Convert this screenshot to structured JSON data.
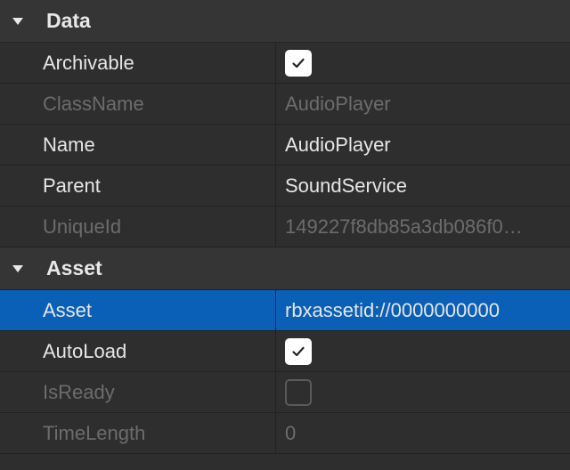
{
  "sections": [
    {
      "title": "Data",
      "rows": [
        {
          "name": "Archivable",
          "type": "checkbox",
          "checked": true,
          "enabled": true
        },
        {
          "name": "ClassName",
          "type": "text",
          "value": "AudioPlayer",
          "enabled": false
        },
        {
          "name": "Name",
          "type": "text",
          "value": "AudioPlayer",
          "enabled": true
        },
        {
          "name": "Parent",
          "type": "text",
          "value": "SoundService",
          "enabled": true
        },
        {
          "name": "UniqueId",
          "type": "text",
          "value": "149227f8db85a3db086f0…",
          "enabled": false
        }
      ]
    },
    {
      "title": "Asset",
      "rows": [
        {
          "name": "Asset",
          "type": "text",
          "value": "rbxassetid://0000000000",
          "enabled": true,
          "selected": true
        },
        {
          "name": "AutoLoad",
          "type": "checkbox",
          "checked": true,
          "enabled": true
        },
        {
          "name": "IsReady",
          "type": "checkbox",
          "checked": false,
          "enabled": false
        },
        {
          "name": "TimeLength",
          "type": "text",
          "value": "0",
          "enabled": false
        }
      ]
    }
  ],
  "colors": {
    "background": "#2e2e2e",
    "header": "#353535",
    "selected": "#0a5fb6",
    "text": "#e6e6e6",
    "disabled_text": "#6c6c6c",
    "divider": "#222222"
  },
  "icons": {
    "collapse": "chevron-down-icon",
    "check": "checkmark-icon"
  }
}
